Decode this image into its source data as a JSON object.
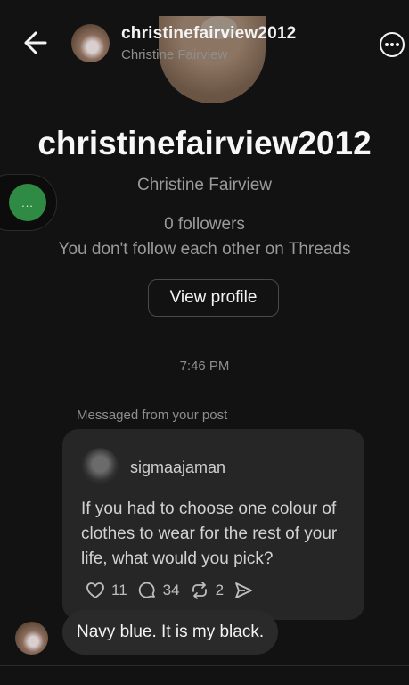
{
  "header": {
    "username": "christinefairview2012",
    "full_name": "Christine Fairview"
  },
  "profile": {
    "username": "christinefairview2012",
    "full_name": "Christine Fairview",
    "followers": "0 followers",
    "relationship": "You don't follow each other on Threads",
    "view_profile_label": "View profile"
  },
  "conversation": {
    "timestamp": "7:46 PM",
    "context_label": "Messaged from your post",
    "shared_post": {
      "author": "sigmaajaman",
      "text": "If you had to choose one colour of clothes to wear for the rest of your life, what would you pick?",
      "likes": "11",
      "replies": "34",
      "reposts": "2"
    },
    "reply": {
      "text": "Navy blue. It is my black."
    }
  },
  "chat_head": {
    "label": "..."
  },
  "icons": {
    "back": "arrow-left-icon",
    "menu": "more-options-icon",
    "like": "heart-icon",
    "comment": "comment-icon",
    "repost": "repost-icon",
    "share": "send-icon"
  },
  "colors": {
    "background": "#121212",
    "card": "#262626",
    "chat_head": "#2f8a43"
  }
}
